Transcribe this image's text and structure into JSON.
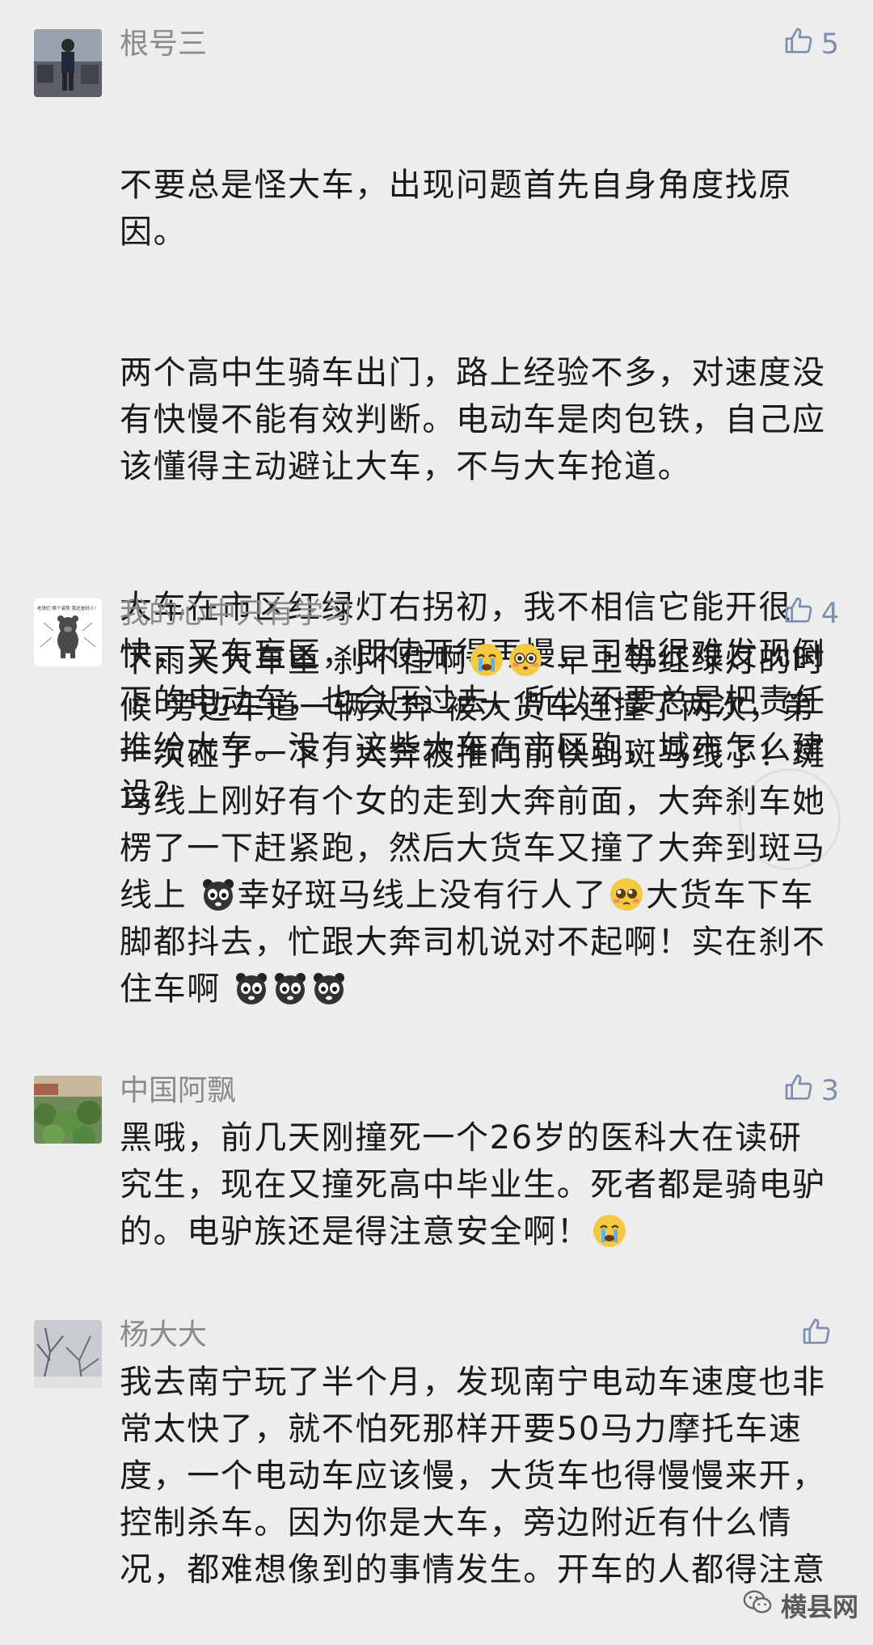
{
  "comments": [
    {
      "name": "根号三",
      "likes": "5",
      "avatar_icon": "photo-avatar-person-street",
      "paragraphs": [
        "不要总是怪大车，出现问题首先自身角度找原因。",
        "两个高中生骑车出门，路上经验不多，对速度没有快慢不能有效判断。电动车是肉包铁，自己应该懂得主动避让大车，不与大车抢道。",
        "大车在市区红绿灯右拐初，我不相信它能开很快，又有盲区，即使开得再慢，司机很难发现倒下的电动车，也会压过去，所以不要总是把责任推给大车。没有这些大车在市区跑，城市怎么建设？"
      ]
    },
    {
      "name": "我的心中只有学习",
      "likes": "4",
      "avatar_icon": "cartoon-bear-avatar",
      "avatar_caption": "老铁们 换个姿势 我还是好人！"
    },
    {
      "name": "中国阿飘",
      "likes": "3",
      "avatar_icon": "green-plants-avatar",
      "text": "黑哦，前几天刚撞死一个26岁的医科大在读研究生，现在又撞死高中毕业生。死者都是骑电驴的。电驴族还是得注意安全啊！"
    },
    {
      "name": "杨大大",
      "likes": "",
      "avatar_icon": "snowy-branches-avatar",
      "text": "我去南宁玩了半个月，发现南宁电动车速度也非常太快了，就不怕死那样开要50马力摩托车速度，一个电动车应该慢，大货车也得慢慢来开，控制杀车。因为你是大车，旁边附近有什么情况，都难想像到的事情发生。开车的人都得注意"
    }
  ],
  "comment2_parts": {
    "a": "下雨天大车重 刹不住啊",
    "b": " 早上等红绿灯的时候 旁边车道一辆大奔 被大货车连撞了两次，第一次碰了一下，大奔被推向前快到斑马线了！斑马线上刚好有个女的走到大奔前面，大奔刹车她楞了一下赶紧跑，然后大货车又撞了大奔到斑马线上 ",
    "c": "幸好斑马线上没有行人了",
    "d": "大货车下车脚都抖去，忙跟大奔司机说对不起啊！实在刹不住车啊 "
  },
  "comment3_tail_emoji": "crying-face-emoji",
  "emoji_names": [
    "crying-face-emoji",
    "flushed-face-emoji",
    "panda-face-emoji",
    "pleading-face-emoji"
  ],
  "watermark": {
    "text": "横县网",
    "icon": "wechat-icon"
  },
  "colors": {
    "background": "#ededed",
    "name": "#8a8a8a",
    "like": "#7d8fb0",
    "text": "#1a1a1a"
  }
}
